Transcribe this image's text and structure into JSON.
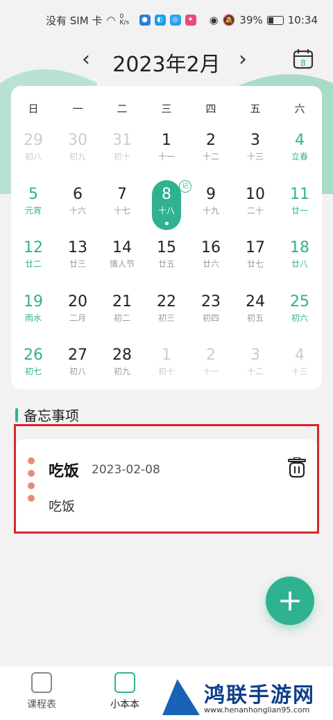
{
  "status": {
    "carrier": "没有 SIM 卡",
    "net_speed": "0 K/s",
    "battery": "39%",
    "time": "10:34"
  },
  "nav": {
    "month": "2023年2月",
    "prev": "‹",
    "next": "›",
    "today_badge": "8"
  },
  "weekdays": [
    "日",
    "一",
    "二",
    "三",
    "四",
    "五",
    "六"
  ],
  "days": [
    {
      "n": "29",
      "l": "初八",
      "t": "other"
    },
    {
      "n": "30",
      "l": "初九",
      "t": "other"
    },
    {
      "n": "31",
      "l": "初十",
      "t": "other"
    },
    {
      "n": "1",
      "l": "十一",
      "t": ""
    },
    {
      "n": "2",
      "l": "十二",
      "t": ""
    },
    {
      "n": "3",
      "l": "十三",
      "t": ""
    },
    {
      "n": "4",
      "l": "立春",
      "t": "green"
    },
    {
      "n": "5",
      "l": "元宵",
      "t": "green"
    },
    {
      "n": "6",
      "l": "十六",
      "t": ""
    },
    {
      "n": "7",
      "l": "十七",
      "t": ""
    },
    {
      "n": "8",
      "l": "十八",
      "t": "sel",
      "badge": "记"
    },
    {
      "n": "9",
      "l": "十九",
      "t": ""
    },
    {
      "n": "10",
      "l": "二十",
      "t": ""
    },
    {
      "n": "11",
      "l": "廿一",
      "t": "green"
    },
    {
      "n": "12",
      "l": "廿二",
      "t": "green"
    },
    {
      "n": "13",
      "l": "廿三",
      "t": ""
    },
    {
      "n": "14",
      "l": "情人节",
      "t": ""
    },
    {
      "n": "15",
      "l": "廿五",
      "t": ""
    },
    {
      "n": "16",
      "l": "廿六",
      "t": ""
    },
    {
      "n": "17",
      "l": "廿七",
      "t": ""
    },
    {
      "n": "18",
      "l": "廿八",
      "t": "green"
    },
    {
      "n": "19",
      "l": "雨水",
      "t": "green"
    },
    {
      "n": "20",
      "l": "二月",
      "t": ""
    },
    {
      "n": "21",
      "l": "初二",
      "t": ""
    },
    {
      "n": "22",
      "l": "初三",
      "t": ""
    },
    {
      "n": "23",
      "l": "初四",
      "t": ""
    },
    {
      "n": "24",
      "l": "初五",
      "t": ""
    },
    {
      "n": "25",
      "l": "初六",
      "t": "green"
    },
    {
      "n": "26",
      "l": "初七",
      "t": "green"
    },
    {
      "n": "27",
      "l": "初八",
      "t": ""
    },
    {
      "n": "28",
      "l": "初九",
      "t": ""
    },
    {
      "n": "1",
      "l": "初十",
      "t": "other"
    },
    {
      "n": "2",
      "l": "十一",
      "t": "other"
    },
    {
      "n": "3",
      "l": "十二",
      "t": "other"
    },
    {
      "n": "4",
      "l": "十三",
      "t": "other"
    }
  ],
  "memo": {
    "section_title": "备忘事项",
    "title": "吃饭",
    "date": "2023-02-08",
    "body": "吃饭"
  },
  "fab": {
    "label": "+"
  },
  "tabs": [
    {
      "label": "课程表"
    },
    {
      "label": "小本本"
    }
  ],
  "watermark": {
    "title": "鸿联手游网",
    "url": "www.henanhonglian95.com"
  },
  "colors": {
    "accent": "#2fb28f",
    "highlight": "#d9252c"
  }
}
